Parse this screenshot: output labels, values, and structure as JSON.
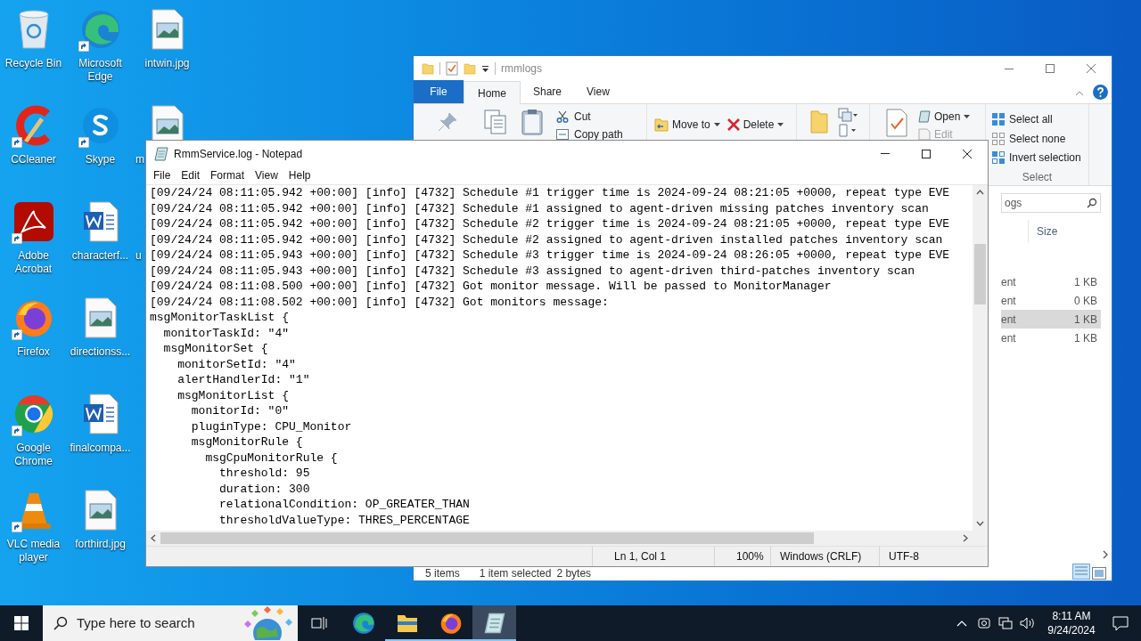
{
  "desktop_icons": [
    {
      "label": "Recycle Bin",
      "kind": "recycle-bin",
      "shortcut": false,
      "clipped": false
    },
    {
      "label": "CCleaner",
      "kind": "ccleaner",
      "shortcut": true,
      "clipped": false
    },
    {
      "label": "Adobe Acrobat",
      "kind": "acrobat",
      "shortcut": true,
      "clipped": false
    },
    {
      "label": "Firefox",
      "kind": "firefox",
      "shortcut": true,
      "clipped": false
    },
    {
      "label": "Google Chrome",
      "kind": "chrome",
      "shortcut": true,
      "clipped": false
    },
    {
      "label": "VLC media player",
      "kind": "vlc",
      "shortcut": true,
      "clipped": false
    },
    {
      "label": "Microsoft Edge",
      "kind": "edge",
      "shortcut": true,
      "clipped": false
    },
    {
      "label": "Skype",
      "kind": "skype",
      "shortcut": true,
      "clipped": false
    },
    {
      "label": "characterf...",
      "kind": "word",
      "shortcut": false,
      "clipped": false
    },
    {
      "label": "directionss...",
      "kind": "image",
      "shortcut": false,
      "clipped": false
    },
    {
      "label": "finalcompa...",
      "kind": "word",
      "shortcut": false,
      "clipped": false
    },
    {
      "label": "forthird.jpg",
      "kind": "image",
      "shortcut": false,
      "clipped": false
    },
    {
      "label": "intwin.jpg",
      "kind": "image",
      "shortcut": false,
      "clipped": false
    },
    {
      "label": "m",
      "kind": "image",
      "shortcut": false,
      "clipped": true
    },
    {
      "label": "u",
      "kind": "none",
      "shortcut": false,
      "clipped": true
    }
  ],
  "explorer": {
    "title": "rmmlogs",
    "tabs": [
      {
        "label": "File",
        "kind": "backstage",
        "selected": false
      },
      {
        "label": "Home",
        "kind": "tab",
        "selected": true
      },
      {
        "label": "Share",
        "kind": "tab",
        "selected": false
      },
      {
        "label": "View",
        "kind": "tab",
        "selected": false
      }
    ],
    "ribbon": {
      "cut": "Cut",
      "copy_path": "Copy path",
      "move_to": "Move to",
      "delete": "Delete",
      "open": "Open",
      "edit": {
        "label": "Edit",
        "disabled": true
      },
      "select_items": [
        {
          "label": "Select all",
          "kind": "all"
        },
        {
          "label": "Select none",
          "kind": "none"
        },
        {
          "label": "Invert selection",
          "kind": "invert"
        }
      ],
      "select_group": "Select"
    },
    "search_value": "ogs",
    "size_column": "Size",
    "rows": [
      {
        "type": "ent",
        "size": "1 KB",
        "selected": false
      },
      {
        "type": "ent",
        "size": "0 KB",
        "selected": false
      },
      {
        "type": "ent",
        "size": "1 KB",
        "selected": true
      },
      {
        "type": "ent",
        "size": "1 KB",
        "selected": false
      }
    ],
    "status": {
      "count": "5 items",
      "selection": "1 item selected",
      "bytes": "2 bytes"
    }
  },
  "notepad": {
    "title": "RmmService.log - Notepad",
    "menu": [
      "File",
      "Edit",
      "Format",
      "View",
      "Help"
    ],
    "lines": [
      "[09/24/24 08:11:05.942 +00:00] [info] [4732] Schedule #1 trigger time is 2024-09-24 08:21:05 +0000, repeat type EVE",
      "[09/24/24 08:11:05.942 +00:00] [info] [4732] Schedule #1 assigned to agent-driven missing patches inventory scan",
      "[09/24/24 08:11:05.942 +00:00] [info] [4732] Schedule #2 trigger time is 2024-09-24 08:21:05 +0000, repeat type EVE",
      "[09/24/24 08:11:05.942 +00:00] [info] [4732] Schedule #2 assigned to agent-driven installed patches inventory scan",
      "[09/24/24 08:11:05.943 +00:00] [info] [4732] Schedule #3 trigger time is 2024-09-24 08:26:05 +0000, repeat type EVE",
      "[09/24/24 08:11:05.943 +00:00] [info] [4732] Schedule #3 assigned to agent-driven third-patches inventory scan",
      "[09/24/24 08:11:08.500 +00:00] [info] [4732] Got monitor message. Will be passed to MonitorManager",
      "[09/24/24 08:11:08.502 +00:00] [info] [4732] Got monitors message:",
      "msgMonitorTaskList {",
      "  monitorTaskId: \"4\"",
      "  msgMonitorSet {",
      "    monitorSetId: \"4\"",
      "    alertHandlerId: \"1\"",
      "    msgMonitorList {",
      "      monitorId: \"0\"",
      "      pluginType: CPU_Monitor",
      "      msgMonitorRule {",
      "        msgCpuMonitorRule {",
      "          threshold: 95",
      "          duration: 300",
      "          relationalCondition: OP_GREATER_THAN",
      "          thresholdValueType: THRES_PERCENTAGE"
    ],
    "status": {
      "position": "Ln 1, Col 1",
      "zoom": "100%",
      "line_ending": "Windows (CRLF)",
      "encoding": "UTF-8"
    }
  },
  "taskbar": {
    "search_placeholder": "Type here to search",
    "apps": [
      {
        "kind": "task-view",
        "running": false,
        "selected": false
      },
      {
        "kind": "edge",
        "running": false,
        "selected": false
      },
      {
        "kind": "explorer",
        "running": true,
        "selected": false
      },
      {
        "kind": "firefox",
        "running": true,
        "selected": false
      },
      {
        "kind": "notepad",
        "running": true,
        "selected": true
      }
    ],
    "time": "8:11 AM",
    "date": "9/24/2024"
  }
}
